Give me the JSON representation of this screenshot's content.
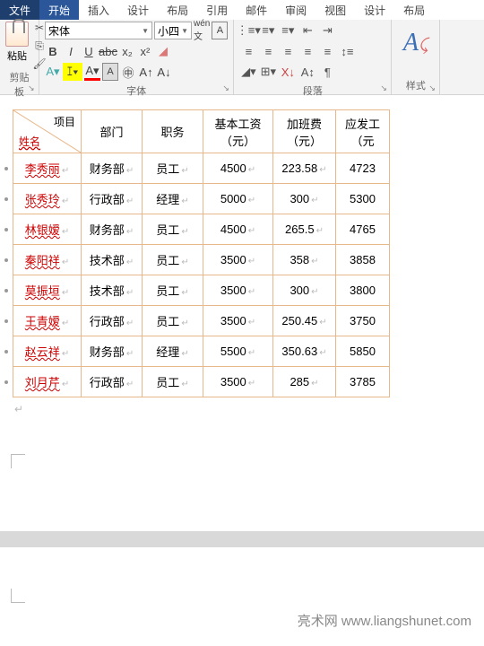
{
  "tabs": [
    "文件",
    "开始",
    "插入",
    "设计",
    "布局",
    "引用",
    "邮件",
    "审阅",
    "视图",
    "设计",
    "布局"
  ],
  "clipboard": {
    "label": "粘贴",
    "group": "剪贴板"
  },
  "font": {
    "family": "宋体",
    "size": "小四",
    "group": "字体"
  },
  "para": {
    "group": "段落"
  },
  "styles": {
    "label": "样式"
  },
  "table": {
    "diag_top": "项目",
    "diag_bottom": "姓名",
    "headers": [
      "部门",
      "职务",
      "基本工资（元）",
      "加班费（元）",
      "应发工（元"
    ],
    "rows": [
      {
        "n": "李秀丽",
        "d": "财务部",
        "j": "员工",
        "b": "4500",
        "o": "223.58",
        "t": "4723"
      },
      {
        "n": "张秀玲",
        "d": "行政部",
        "j": "经理",
        "b": "5000",
        "o": "300",
        "t": "5300"
      },
      {
        "n": "林银嫒",
        "d": "财务部",
        "j": "员工",
        "b": "4500",
        "o": "265.5",
        "t": "4765"
      },
      {
        "n": "秦阳祥",
        "d": "技术部",
        "j": "员工",
        "b": "3500",
        "o": "358",
        "t": "3858"
      },
      {
        "n": "莫振垣",
        "d": "技术部",
        "j": "员工",
        "b": "3500",
        "o": "300",
        "t": "3800"
      },
      {
        "n": "王青嫒",
        "d": "行政部",
        "j": "员工",
        "b": "3500",
        "o": "250.45",
        "t": "3750"
      },
      {
        "n": "赵云祥",
        "d": "财务部",
        "j": "经理",
        "b": "5500",
        "o": "350.63",
        "t": "5850"
      },
      {
        "n": "刘月芹",
        "d": "行政部",
        "j": "员工",
        "b": "3500",
        "o": "285",
        "t": "3785"
      }
    ]
  },
  "footer": "亮术网 www.liangshunet.com"
}
